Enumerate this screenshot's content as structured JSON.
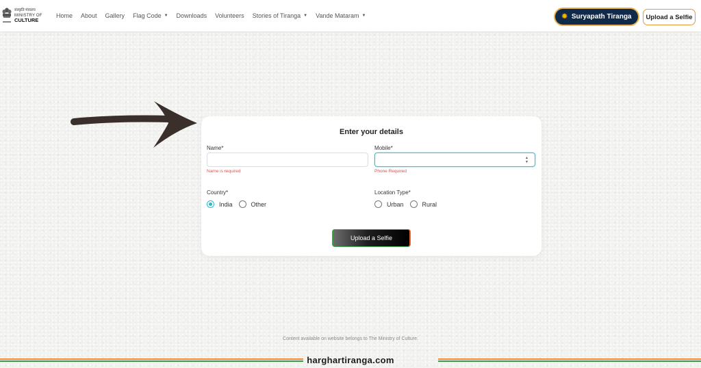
{
  "header": {
    "logo": {
      "hindi_text": "संस्कृति मंत्रालय",
      "line1": "MINISTRY OF",
      "line2": "CULTURE"
    },
    "nav": [
      {
        "label": "Home",
        "has_dropdown": false
      },
      {
        "label": "About",
        "has_dropdown": false
      },
      {
        "label": "Gallery",
        "has_dropdown": false
      },
      {
        "label": "Flag Code",
        "has_dropdown": true
      },
      {
        "label": "Downloads",
        "has_dropdown": false
      },
      {
        "label": "Volunteers",
        "has_dropdown": false
      },
      {
        "label": "Stories of Tiranga",
        "has_dropdown": true
      },
      {
        "label": "Vande Mataram",
        "has_dropdown": true
      }
    ],
    "suryapath_button": "Suryapath Tiranga",
    "upload_button": "Upload a Selfie"
  },
  "form": {
    "title": "Enter your details",
    "name": {
      "label": "Name*",
      "value": "",
      "error": "Name is required"
    },
    "mobile": {
      "label": "Mobile*",
      "value": "",
      "error": "Phone Required"
    },
    "country": {
      "label": "Country*",
      "options": [
        {
          "label": "India",
          "checked": true
        },
        {
          "label": "Other",
          "checked": false
        }
      ]
    },
    "location_type": {
      "label": "Location Type*",
      "options": [
        {
          "label": "Urban",
          "checked": false
        },
        {
          "label": "Rural",
          "checked": false
        }
      ]
    },
    "submit_label": "Upload a Selfie"
  },
  "footer": {
    "note": "Content available on website belongs to The Ministry of Culture.",
    "site": "harghartiranga.com"
  },
  "colors": {
    "saffron": "#f08a2c",
    "green": "#3b9a3e",
    "navy": "#0f2a4a",
    "focus": "#38c5d0",
    "error": "#e0524f"
  }
}
